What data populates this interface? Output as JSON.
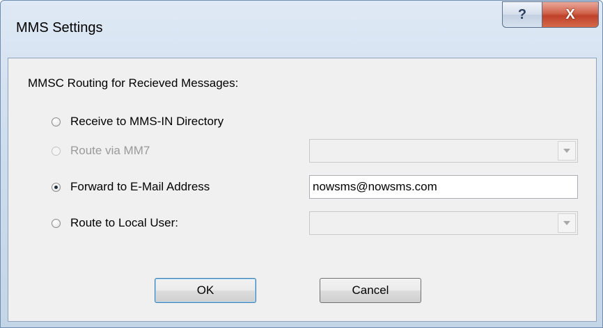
{
  "window": {
    "title": "MMS Settings",
    "help_label": "?",
    "close_label": "X"
  },
  "routing": {
    "section_label": "MMSC Routing for Recieved Messages:",
    "options": [
      {
        "label": "Receive to MMS-IN Directory",
        "selected": false,
        "enabled": true
      },
      {
        "label": "Route via MM7",
        "selected": false,
        "enabled": false
      },
      {
        "label": "Forward to E-Mail Address",
        "selected": true,
        "enabled": true
      },
      {
        "label": "Route to Local User:",
        "selected": false,
        "enabled": true
      }
    ],
    "mm7_combo_value": "",
    "email_value": "nowsms@nowsms.com",
    "local_user_combo_value": ""
  },
  "buttons": {
    "ok_label": "OK",
    "cancel_label": "Cancel"
  },
  "icons": {
    "help": "help-icon",
    "close": "close-icon",
    "dropdown": "chevron-down-icon"
  }
}
